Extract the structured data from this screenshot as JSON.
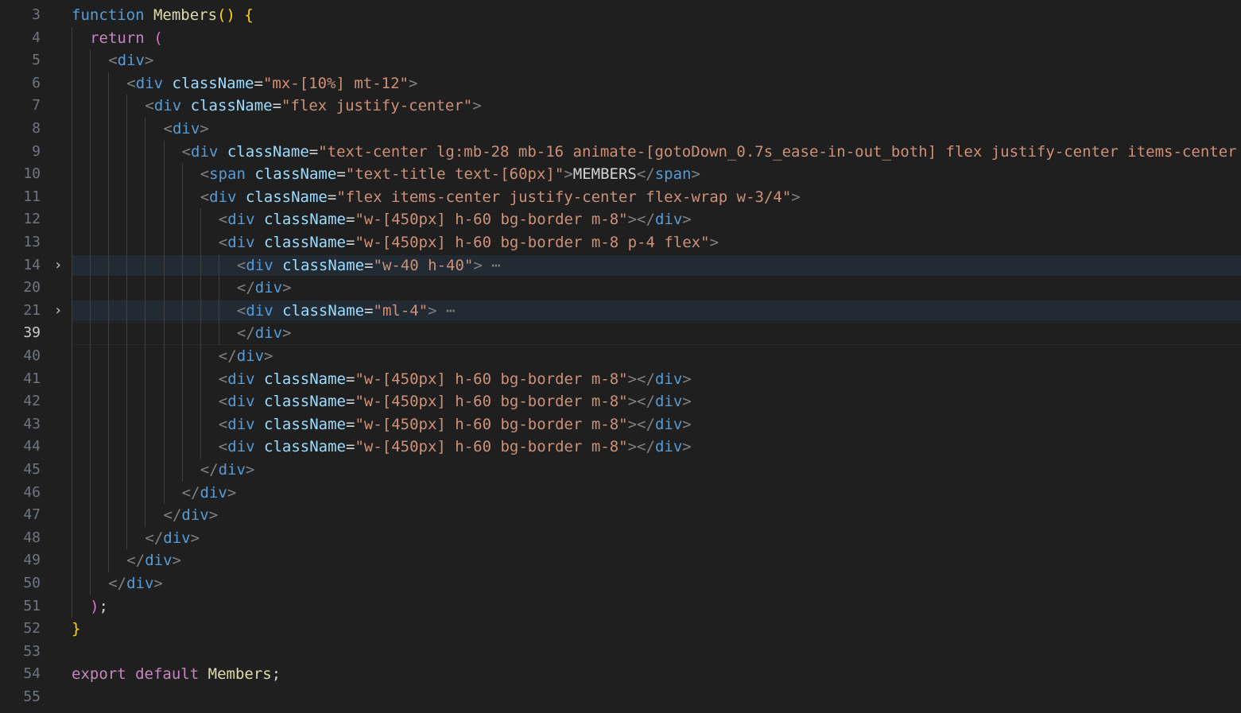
{
  "editor": {
    "lines": [
      {
        "num": "3",
        "tokens": [
          [
            "kw",
            "function"
          ],
          [
            "txt",
            " "
          ],
          [
            "fn",
            "Members"
          ],
          [
            "br1",
            "()"
          ],
          [
            "txt",
            " "
          ],
          [
            "br1",
            "{"
          ]
        ]
      },
      {
        "num": "4",
        "indent": 1,
        "tokens": [
          [
            "ctl",
            "return"
          ],
          [
            "txt",
            " "
          ],
          [
            "br2",
            "("
          ]
        ]
      },
      {
        "num": "5",
        "indent": 2,
        "tokens": [
          [
            "tagp",
            "<"
          ],
          [
            "tag",
            "div"
          ],
          [
            "tagp",
            ">"
          ]
        ]
      },
      {
        "num": "6",
        "indent": 3,
        "tokens": [
          [
            "tagp",
            "<"
          ],
          [
            "tag",
            "div"
          ],
          [
            "txt",
            " "
          ],
          [
            "attr",
            "className"
          ],
          [
            "eq",
            "="
          ],
          [
            "str",
            "\"mx-[10%] mt-12\""
          ],
          [
            "tagp",
            ">"
          ]
        ]
      },
      {
        "num": "7",
        "indent": 4,
        "tokens": [
          [
            "tagp",
            "<"
          ],
          [
            "tag",
            "div"
          ],
          [
            "txt",
            " "
          ],
          [
            "attr",
            "className"
          ],
          [
            "eq",
            "="
          ],
          [
            "str",
            "\"flex justify-center\""
          ],
          [
            "tagp",
            ">"
          ]
        ]
      },
      {
        "num": "8",
        "indent": 5,
        "tokens": [
          [
            "tagp",
            "<"
          ],
          [
            "tag",
            "div"
          ],
          [
            "tagp",
            ">"
          ]
        ]
      },
      {
        "num": "9",
        "indent": 6,
        "tokens": [
          [
            "tagp",
            "<"
          ],
          [
            "tag",
            "div"
          ],
          [
            "txt",
            " "
          ],
          [
            "attr",
            "className"
          ],
          [
            "eq",
            "="
          ],
          [
            "str",
            "\"text-center lg:mb-28 mb-16 animate-[gotoDown_0.7s_ease-in-out_both] flex justify-center items-center"
          ]
        ]
      },
      {
        "num": "10",
        "indent": 7,
        "tokens": [
          [
            "tagp",
            "<"
          ],
          [
            "tag",
            "span"
          ],
          [
            "txt",
            " "
          ],
          [
            "attr",
            "className"
          ],
          [
            "eq",
            "="
          ],
          [
            "str",
            "\"text-title text-[60px]\""
          ],
          [
            "tagp",
            ">"
          ],
          [
            "txt",
            "MEMBERS"
          ],
          [
            "tagp",
            "</"
          ],
          [
            "tag",
            "span"
          ],
          [
            "tagp",
            ">"
          ]
        ]
      },
      {
        "num": "11",
        "indent": 7,
        "tokens": [
          [
            "tagp",
            "<"
          ],
          [
            "tag",
            "div"
          ],
          [
            "txt",
            " "
          ],
          [
            "attr",
            "className"
          ],
          [
            "eq",
            "="
          ],
          [
            "str",
            "\"flex items-center justify-center flex-wrap w-3/4\""
          ],
          [
            "tagp",
            ">"
          ]
        ]
      },
      {
        "num": "12",
        "indent": 8,
        "tokens": [
          [
            "tagp",
            "<"
          ],
          [
            "tag",
            "div"
          ],
          [
            "txt",
            " "
          ],
          [
            "attr",
            "className"
          ],
          [
            "eq",
            "="
          ],
          [
            "str",
            "\"w-[450px] h-60 bg-border m-8\""
          ],
          [
            "tagp",
            "></"
          ],
          [
            "tag",
            "div"
          ],
          [
            "tagp",
            ">"
          ]
        ]
      },
      {
        "num": "13",
        "indent": 8,
        "tokens": [
          [
            "tagp",
            "<"
          ],
          [
            "tag",
            "div"
          ],
          [
            "txt",
            " "
          ],
          [
            "attr",
            "className"
          ],
          [
            "eq",
            "="
          ],
          [
            "str",
            "\"w-[450px] h-60 bg-border m-8 p-4 flex\""
          ],
          [
            "tagp",
            ">"
          ]
        ]
      },
      {
        "num": "14",
        "indent": 9,
        "fold": "›",
        "highlight": true,
        "tokens": [
          [
            "tagp",
            "<"
          ],
          [
            "tag",
            "div"
          ],
          [
            "txt",
            " "
          ],
          [
            "attr",
            "className"
          ],
          [
            "eq",
            "="
          ],
          [
            "str",
            "\"w-40 h-40\""
          ],
          [
            "tagp",
            ">"
          ],
          [
            "dots",
            " ⋯"
          ]
        ]
      },
      {
        "num": "20",
        "indent": 9,
        "tokens": [
          [
            "tagp",
            "</"
          ],
          [
            "tag",
            "div"
          ],
          [
            "tagp",
            ">"
          ]
        ]
      },
      {
        "num": "21",
        "indent": 9,
        "fold": "›",
        "highlight": true,
        "tokens": [
          [
            "tagp",
            "<"
          ],
          [
            "tag",
            "div"
          ],
          [
            "txt",
            " "
          ],
          [
            "attr",
            "className"
          ],
          [
            "eq",
            "="
          ],
          [
            "str",
            "\"ml-4\""
          ],
          [
            "tagp",
            ">"
          ],
          [
            "dots",
            " ⋯"
          ]
        ]
      },
      {
        "num": "39",
        "indent": 9,
        "current": true,
        "tokens": [
          [
            "tagp",
            "</"
          ],
          [
            "tag",
            "div"
          ],
          [
            "tagp",
            ">"
          ]
        ]
      },
      {
        "num": "40",
        "indent": 8,
        "tokens": [
          [
            "tagp",
            "</"
          ],
          [
            "tag",
            "div"
          ],
          [
            "tagp",
            ">"
          ]
        ]
      },
      {
        "num": "41",
        "indent": 8,
        "tokens": [
          [
            "tagp",
            "<"
          ],
          [
            "tag",
            "div"
          ],
          [
            "txt",
            " "
          ],
          [
            "attr",
            "className"
          ],
          [
            "eq",
            "="
          ],
          [
            "str",
            "\"w-[450px] h-60 bg-border m-8\""
          ],
          [
            "tagp",
            "></"
          ],
          [
            "tag",
            "div"
          ],
          [
            "tagp",
            ">"
          ]
        ]
      },
      {
        "num": "42",
        "indent": 8,
        "tokens": [
          [
            "tagp",
            "<"
          ],
          [
            "tag",
            "div"
          ],
          [
            "txt",
            " "
          ],
          [
            "attr",
            "className"
          ],
          [
            "eq",
            "="
          ],
          [
            "str",
            "\"w-[450px] h-60 bg-border m-8\""
          ],
          [
            "tagp",
            "></"
          ],
          [
            "tag",
            "div"
          ],
          [
            "tagp",
            ">"
          ]
        ]
      },
      {
        "num": "43",
        "indent": 8,
        "tokens": [
          [
            "tagp",
            "<"
          ],
          [
            "tag",
            "div"
          ],
          [
            "txt",
            " "
          ],
          [
            "attr",
            "className"
          ],
          [
            "eq",
            "="
          ],
          [
            "str",
            "\"w-[450px] h-60 bg-border m-8\""
          ],
          [
            "tagp",
            "></"
          ],
          [
            "tag",
            "div"
          ],
          [
            "tagp",
            ">"
          ]
        ]
      },
      {
        "num": "44",
        "indent": 8,
        "tokens": [
          [
            "tagp",
            "<"
          ],
          [
            "tag",
            "div"
          ],
          [
            "txt",
            " "
          ],
          [
            "attr",
            "className"
          ],
          [
            "eq",
            "="
          ],
          [
            "str",
            "\"w-[450px] h-60 bg-border m-8\""
          ],
          [
            "tagp",
            "></"
          ],
          [
            "tag",
            "div"
          ],
          [
            "tagp",
            ">"
          ]
        ]
      },
      {
        "num": "45",
        "indent": 7,
        "tokens": [
          [
            "tagp",
            "</"
          ],
          [
            "tag",
            "div"
          ],
          [
            "tagp",
            ">"
          ]
        ]
      },
      {
        "num": "46",
        "indent": 6,
        "tokens": [
          [
            "tagp",
            "</"
          ],
          [
            "tag",
            "div"
          ],
          [
            "tagp",
            ">"
          ]
        ]
      },
      {
        "num": "47",
        "indent": 5,
        "tokens": [
          [
            "tagp",
            "</"
          ],
          [
            "tag",
            "div"
          ],
          [
            "tagp",
            ">"
          ]
        ]
      },
      {
        "num": "48",
        "indent": 4,
        "tokens": [
          [
            "tagp",
            "</"
          ],
          [
            "tag",
            "div"
          ],
          [
            "tagp",
            ">"
          ]
        ]
      },
      {
        "num": "49",
        "indent": 3,
        "tokens": [
          [
            "tagp",
            "</"
          ],
          [
            "tag",
            "div"
          ],
          [
            "tagp",
            ">"
          ]
        ]
      },
      {
        "num": "50",
        "indent": 2,
        "tokens": [
          [
            "tagp",
            "</"
          ],
          [
            "tag",
            "div"
          ],
          [
            "tagp",
            ">"
          ]
        ]
      },
      {
        "num": "51",
        "indent": 1,
        "tokens": [
          [
            "br2",
            ")"
          ],
          [
            "txt",
            ";"
          ]
        ]
      },
      {
        "num": "52",
        "tokens": [
          [
            "br1",
            "}"
          ]
        ]
      },
      {
        "num": "53",
        "tokens": []
      },
      {
        "num": "54",
        "tokens": [
          [
            "ctl",
            "export"
          ],
          [
            "txt",
            " "
          ],
          [
            "ctl",
            "default"
          ],
          [
            "txt",
            " "
          ],
          [
            "fn",
            "Members"
          ],
          [
            "txt",
            ";"
          ]
        ]
      },
      {
        "num": "55",
        "tokens": []
      }
    ]
  }
}
